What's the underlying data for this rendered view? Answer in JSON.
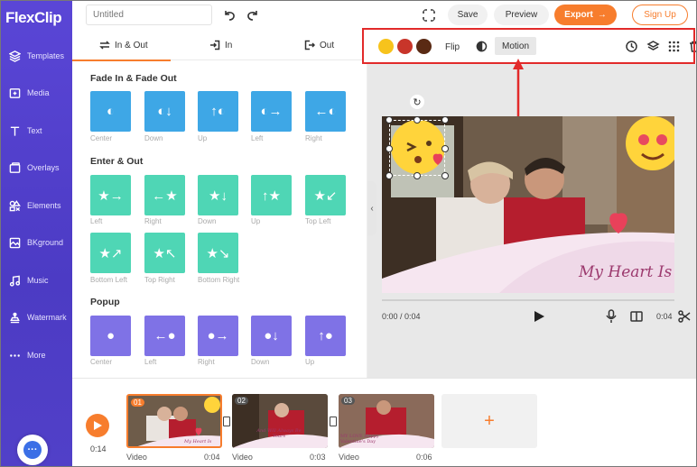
{
  "app": {
    "logo": "FlexClip"
  },
  "colors": {
    "accent": "#f77d2d",
    "sidebar": "#5444cf",
    "highlight": "#e22a2a"
  },
  "sidebar": {
    "items": [
      {
        "label": "Templates",
        "icon": "layers-icon"
      },
      {
        "label": "Media",
        "icon": "media-icon"
      },
      {
        "label": "Text",
        "icon": "text-icon"
      },
      {
        "label": "Overlays",
        "icon": "overlays-icon"
      },
      {
        "label": "Elements",
        "icon": "elements-icon"
      },
      {
        "label": "BKground",
        "icon": "background-icon"
      },
      {
        "label": "Music",
        "icon": "music-icon"
      },
      {
        "label": "Watermark",
        "icon": "watermark-icon"
      },
      {
        "label": "More",
        "icon": "more-icon"
      }
    ]
  },
  "topbar": {
    "title_placeholder": "Untitled",
    "save": "Save",
    "preview": "Preview",
    "export": "Export",
    "signup": "Sign Up"
  },
  "panel": {
    "tabs": [
      "In & Out",
      "In",
      "Out"
    ],
    "sections": [
      {
        "title": "Fade In & Fade Out",
        "items": [
          "Center",
          "Down",
          "Up",
          "Left",
          "Right"
        ]
      },
      {
        "title": "Enter & Out",
        "items": [
          "Left",
          "Right",
          "Down",
          "Up",
          "Top Left",
          "Bottom Left",
          "Top Right",
          "Bottom Right"
        ]
      },
      {
        "title": "Popup",
        "items": [
          "Center",
          "Left",
          "Right",
          "Down",
          "Up"
        ]
      }
    ]
  },
  "toolbar": {
    "swatches": [
      "#f7c31c",
      "#c8352a",
      "#5a2a14"
    ],
    "flip": "Flip",
    "motion": "Motion"
  },
  "canvas": {
    "overlay_text": "My Heart Is"
  },
  "player": {
    "current": "0:00 / 0:04",
    "end": "0:04"
  },
  "timeline": {
    "total": "0:14",
    "clips": [
      {
        "num": "01",
        "label": "Video",
        "duration": "0:04",
        "caption": "My Heart Is"
      },
      {
        "num": "02",
        "label": "Video",
        "duration": "0:03",
        "caption": "And Will Always Be Yours"
      },
      {
        "num": "03",
        "label": "Video",
        "duration": "0:06",
        "caption": "MY LOVE Happy Valentine's Day"
      }
    ]
  }
}
